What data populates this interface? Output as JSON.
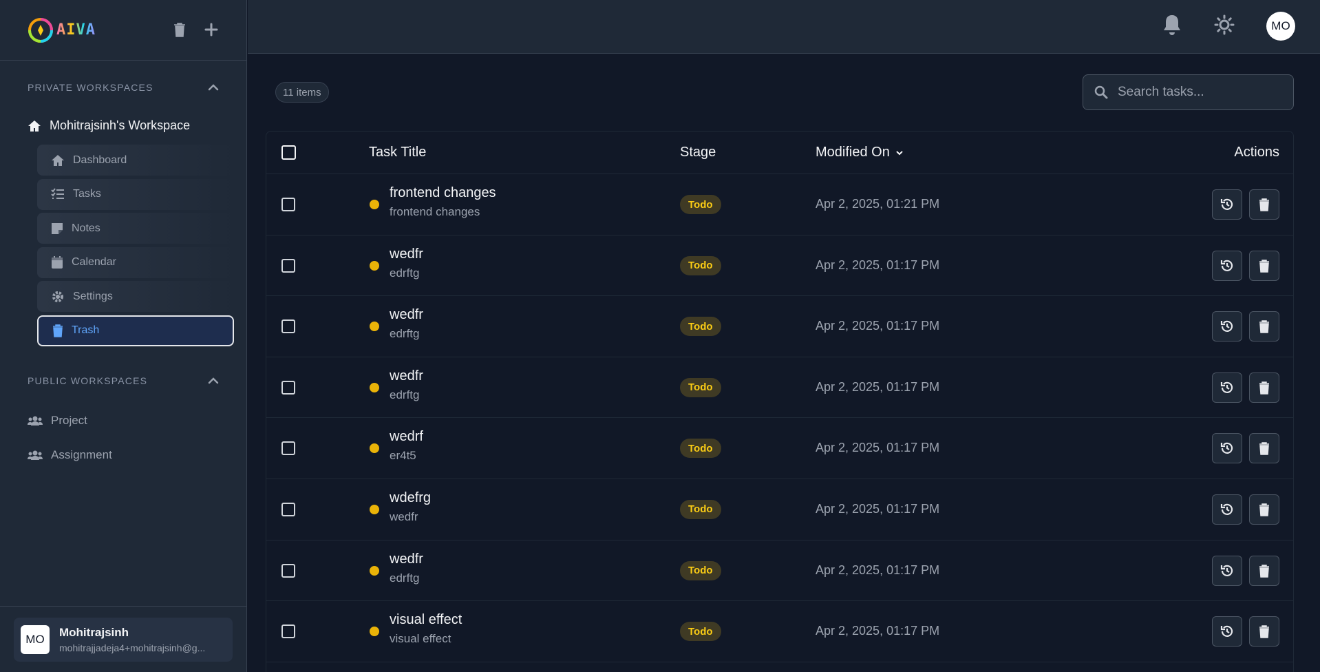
{
  "app": {
    "brand": "AIVA"
  },
  "sidebar": {
    "private_heading": "PRIVATE WORKSPACES",
    "workspace_title": "Mohitrajsinh's Workspace",
    "items": [
      {
        "label": "Dashboard",
        "icon": "home-icon"
      },
      {
        "label": "Tasks",
        "icon": "tasks-icon"
      },
      {
        "label": "Notes",
        "icon": "note-icon"
      },
      {
        "label": "Calendar",
        "icon": "calendar-icon"
      },
      {
        "label": "Settings",
        "icon": "gear-icon"
      },
      {
        "label": "Trash",
        "icon": "trash-icon",
        "active": true
      }
    ],
    "public_heading": "PUBLIC WORKSPACES",
    "public_items": [
      {
        "label": "Project",
        "icon": "users-icon"
      },
      {
        "label": "Assignment",
        "icon": "users-icon"
      }
    ],
    "user": {
      "initials": "MO",
      "name": "Mohitrajsinh",
      "email": "mohitrajjadeja4+mohitrajsinh@g..."
    }
  },
  "header": {
    "avatar_initials": "MO"
  },
  "main": {
    "count_label": "11 items",
    "search_placeholder": "Search tasks...",
    "columns": {
      "title": "Task Title",
      "stage": "Stage",
      "modified": "Modified On",
      "actions": "Actions"
    },
    "rows": [
      {
        "title": "frontend changes",
        "subtitle": "frontend changes",
        "stage": "Todo",
        "modified": "Apr 2, 2025, 01:21 PM"
      },
      {
        "title": "wedfr",
        "subtitle": "edrftg",
        "stage": "Todo",
        "modified": "Apr 2, 2025, 01:17 PM"
      },
      {
        "title": "wedfr",
        "subtitle": "edrftg",
        "stage": "Todo",
        "modified": "Apr 2, 2025, 01:17 PM"
      },
      {
        "title": "wedfr",
        "subtitle": "edrftg",
        "stage": "Todo",
        "modified": "Apr 2, 2025, 01:17 PM"
      },
      {
        "title": "wedrf",
        "subtitle": "er4t5",
        "stage": "Todo",
        "modified": "Apr 2, 2025, 01:17 PM"
      },
      {
        "title": "wdefrg",
        "subtitle": "wedfr",
        "stage": "Todo",
        "modified": "Apr 2, 2025, 01:17 PM"
      },
      {
        "title": "wedfr",
        "subtitle": "edrftg",
        "stage": "Todo",
        "modified": "Apr 2, 2025, 01:17 PM"
      },
      {
        "title": "visual effect",
        "subtitle": "visual effect",
        "stage": "Todo",
        "modified": "Apr 2, 2025, 01:17 PM"
      }
    ]
  },
  "colors": {
    "background": "#111827",
    "panel": "#1f2937",
    "accent": "#60a5fa",
    "todo": "#facc15"
  }
}
